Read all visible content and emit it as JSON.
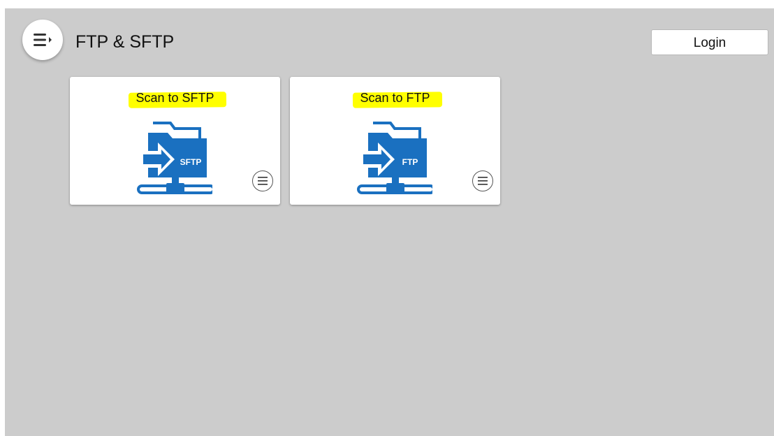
{
  "header": {
    "title": "FTP & SFTP",
    "menu_icon": "hamburger-menu-icon",
    "login_label": "Login"
  },
  "tiles": [
    {
      "label": "Scan to SFTP",
      "icon": "scan-to-sftp-icon",
      "icon_text": "SFTP",
      "menu_icon": "tile-menu-icon"
    },
    {
      "label": "Scan to FTP",
      "icon": "scan-to-ftp-icon",
      "icon_text": "FTP",
      "menu_icon": "tile-menu-icon"
    }
  ],
  "colors": {
    "background": "#cccccc",
    "tile_background": "#ffffff",
    "icon_blue": "#1a70c0",
    "highlight": "#ffff00"
  }
}
